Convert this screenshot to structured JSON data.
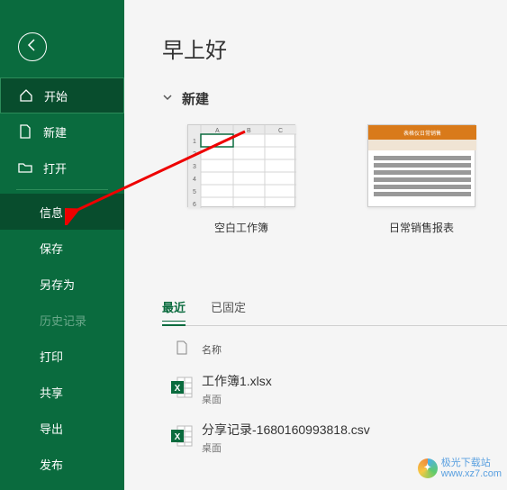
{
  "sidebar": {
    "items": [
      {
        "label": "开始",
        "icon": "home-icon"
      },
      {
        "label": "新建",
        "icon": "new-file-icon"
      },
      {
        "label": "打开",
        "icon": "open-folder-icon"
      },
      {
        "label": "信息"
      },
      {
        "label": "保存"
      },
      {
        "label": "另存为"
      },
      {
        "label": "历史记录"
      },
      {
        "label": "打印"
      },
      {
        "label": "共享"
      },
      {
        "label": "导出"
      },
      {
        "label": "发布"
      }
    ]
  },
  "main": {
    "greeting": "早上好",
    "new_section_label": "新建",
    "templates": [
      {
        "label": "空白工作簿",
        "thumb": "blank"
      },
      {
        "label": "日常销售报表",
        "thumb": "sales"
      }
    ],
    "tabs": [
      {
        "label": "最近"
      },
      {
        "label": "已固定"
      }
    ],
    "file_header_name": "名称",
    "files": [
      {
        "name": "工作簿1.xlsx",
        "location": "桌面"
      },
      {
        "name": "分享记录-1680160993818.csv",
        "location": "桌面"
      }
    ]
  },
  "watermark": {
    "line1": "极光下载站",
    "line2": "www.xz7.com"
  }
}
